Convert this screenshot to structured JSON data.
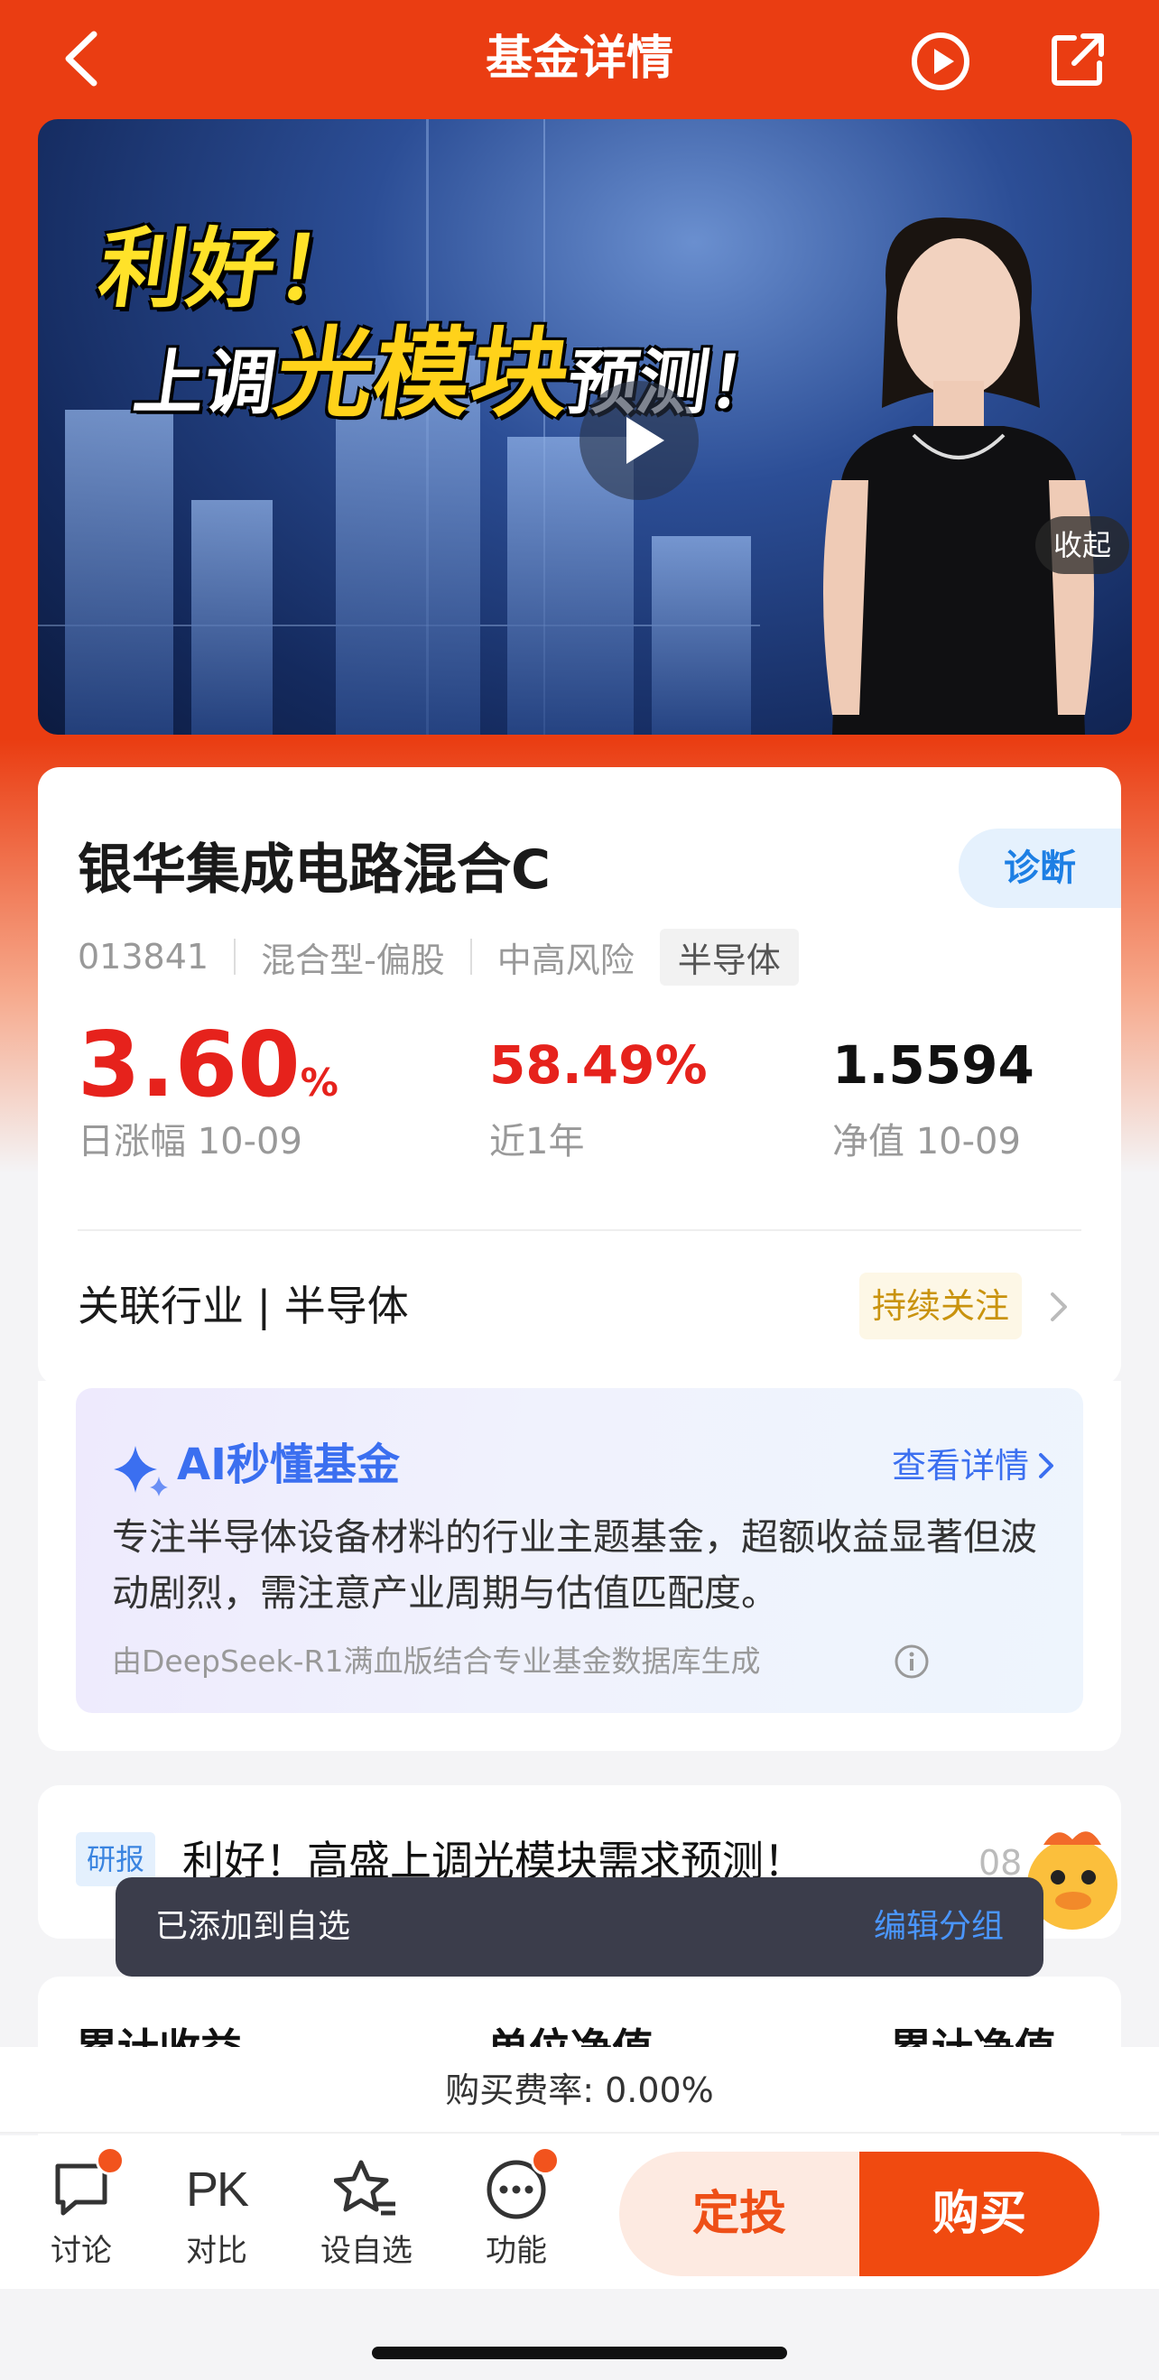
{
  "header": {
    "title": "基金详情"
  },
  "banner": {
    "line1": "利好！",
    "line2_pre": "上调",
    "line2_big": "光模块",
    "line2_post": "预测！",
    "collapse_label": "收起"
  },
  "fund": {
    "name": "银华集成电路混合C",
    "diagnose_label": "诊断",
    "code": "013841",
    "type": "混合型-偏股",
    "risk": "中高风险",
    "sector_tag": "半导体",
    "daily_change": "3.60",
    "daily_change_unit": "%",
    "daily_change_label": "日涨幅 10-09",
    "one_year_return": "58.49%",
    "one_year_label": "近1年",
    "nav": "1.5594",
    "nav_label": "净值 10-09",
    "industry_label": "关联行业 | 半导体",
    "follow_badge": "持续关注"
  },
  "ai": {
    "title": "AI秒懂基金",
    "detail_link": "查看详情",
    "summary": "专注半导体设备材料的行业主题基金，超额收益显著但波动剧烈，需注意产业周期与估值匹配度。",
    "source": "由DeepSeek-R1满血版结合专业基金数据库生成"
  },
  "news": {
    "tag": "研报",
    "title": "利好！高盛上调光模块需求预测！",
    "date": "08"
  },
  "toast": {
    "text": "已添加到自选",
    "action": "编辑分组"
  },
  "returns": {
    "col1": "累计收益",
    "col2": "单位净值",
    "col3": "累计净值"
  },
  "fee": {
    "text": "购买费率: 0.00%"
  },
  "toolbar": {
    "discuss": "讨论",
    "pk_icon_text": "PK",
    "compare": "对比",
    "watchlist": "设自选",
    "functions": "功能",
    "auto_invest": "定投",
    "buy": "购买"
  },
  "colors": {
    "brand_red": "#ea3d12",
    "rise_red": "#e6221c",
    "ai_blue": "#3b6ff0"
  }
}
